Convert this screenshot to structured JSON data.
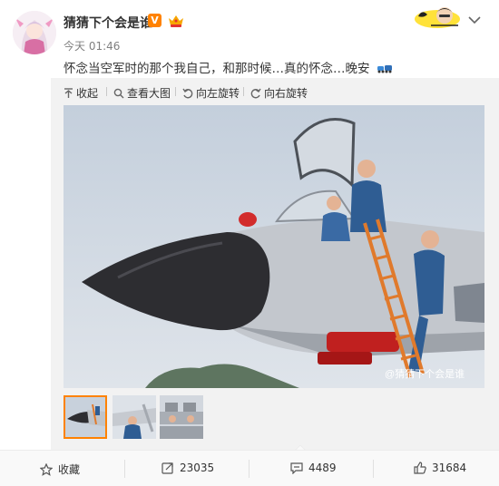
{
  "user": {
    "name": "猜猜下个会是谁",
    "verified_badge": "V",
    "time": "今天 01:46"
  },
  "post": {
    "text": "怀念当空军时的那个我自己，和那时候…真的怀念…晚安"
  },
  "toolbar": {
    "collapse": "收起",
    "view_large": "查看大图",
    "rotate_left": "向左旋转",
    "rotate_right": "向右旋转"
  },
  "image": {
    "watermark": "@猜猜下个会是谁"
  },
  "actions": {
    "favorite": "收藏",
    "repost_count": "23035",
    "comment_count": "4489",
    "like_count": "31684"
  },
  "colors": {
    "accent": "#ff8200",
    "sky": "#c9d3df",
    "jet": "#c2c6cb",
    "nose": "#2b2b2e"
  },
  "icons": [
    "star-icon",
    "repost-icon",
    "comment-icon",
    "thumb-up-icon",
    "rotate-left-icon",
    "rotate-right-icon",
    "magnifier-icon",
    "collapse-icon",
    "chevron-down-icon"
  ]
}
